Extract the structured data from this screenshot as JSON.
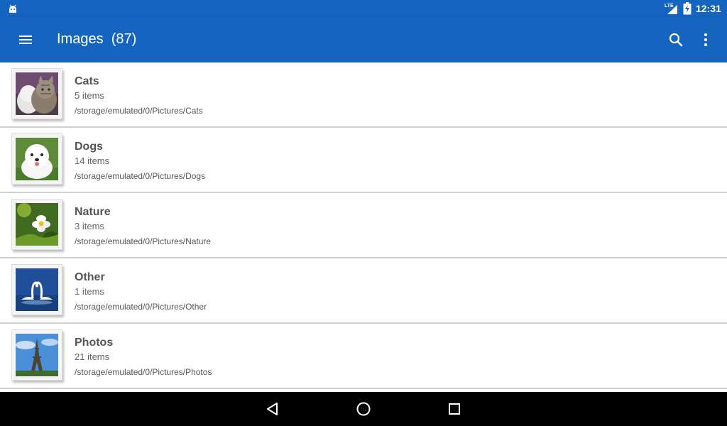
{
  "status_bar": {
    "time": "12:31",
    "network": "LTE",
    "icons": [
      "android-icon",
      "lte-signal-icon",
      "battery-charging-icon"
    ]
  },
  "toolbar": {
    "title": "Images  (87)",
    "menu_icon": "menu-icon",
    "search_icon": "search-icon",
    "more_icon": "more-vert-icon"
  },
  "folders": [
    {
      "name": "Cats",
      "count": "5 items",
      "path": "/storage/emulated/0/Pictures/Cats",
      "thumb": "cats"
    },
    {
      "name": "Dogs",
      "count": "14 items",
      "path": "/storage/emulated/0/Pictures/Dogs",
      "thumb": "dog"
    },
    {
      "name": "Nature",
      "count": "3 items",
      "path": "/storage/emulated/0/Pictures/Nature",
      "thumb": "flower"
    },
    {
      "name": "Other",
      "count": "1 items",
      "path": "/storage/emulated/0/Pictures/Other",
      "thumb": "swans"
    },
    {
      "name": "Photos",
      "count": "21 items",
      "path": "/storage/emulated/0/Pictures/Photos",
      "thumb": "eiffel-tower"
    }
  ],
  "nav_bar": {
    "icons": [
      "back-icon",
      "home-icon",
      "recents-icon"
    ]
  },
  "colors": {
    "primary": "#1565c0",
    "divider": "#d0d0d0",
    "nav_background": "#000000"
  }
}
